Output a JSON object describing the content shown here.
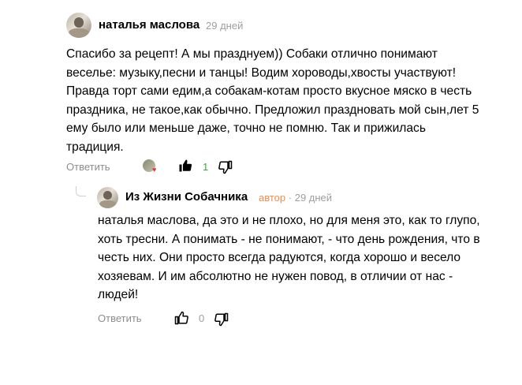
{
  "comment": {
    "author": "наталья маслова",
    "time": "29 дней",
    "text": "Спасибо за рецепт! А мы празднуем)) Собаки отлично понимают веселье: музыку,песни и танцы! Водим хороводы,хвосты участвуют! Правда торт сами едим,а собакам-котам просто вкусное мяско в честь праздника, не такое,как обычно. Предложил праздновать мой сын,лет 5 ему было или меньше даже, точно не помню. Так и прижилась традиция.",
    "reply_label": "Ответить",
    "likes": "1",
    "colors": {
      "likes": "#3aa83a"
    }
  },
  "reply": {
    "author": "Из Жизни Собачника",
    "badge": "автор",
    "separator": "·",
    "time": "29 дней",
    "text": "наталья маслова, да это и не плохо, но для меня это, как то глупо, хоть тресни. А понимать - не понимают, - что день рождения, что в честь них. Они просто всегда радуются, когда хорошо и весело хозяевам. И им абсолютно не нужен повод, в отличии от нас - людей!",
    "reply_label": "Ответить",
    "likes": "0",
    "colors": {
      "badge": "#f28c4b",
      "likes": "#9e9e9e"
    }
  },
  "icons": {
    "like": "thumbs-up-icon",
    "dislike": "thumbs-down-icon",
    "heart": "heart-icon"
  }
}
